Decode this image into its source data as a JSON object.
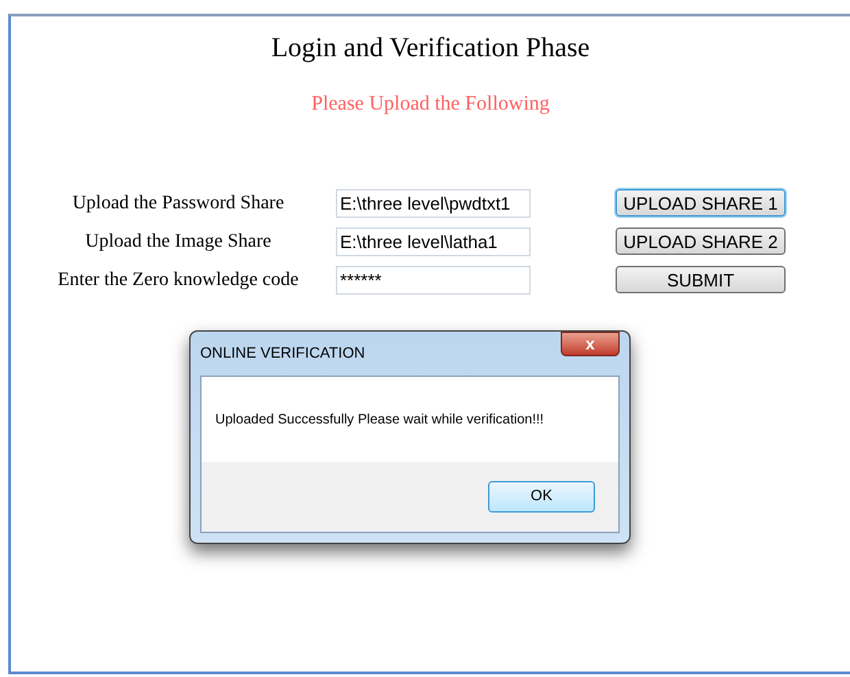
{
  "page": {
    "title": "Login and Verification Phase",
    "subtitle": "Please Upload the Following"
  },
  "rows": [
    {
      "label": "Upload the Password Share",
      "value": "E:\\three level\\pwdtxt1",
      "button": "UPLOAD SHARE 1",
      "focused": true
    },
    {
      "label": "Upload the Image Share",
      "value": "E:\\three level\\latha1",
      "button": "UPLOAD SHARE 2",
      "focused": false
    },
    {
      "label": "Enter the Zero knowledge code",
      "value": "******",
      "button": "SUBMIT",
      "focused": false
    }
  ],
  "dialog": {
    "title": "ONLINE VERIFICATION",
    "close": "x",
    "message": "Uploaded Successfully Please wait while verification!!!",
    "button": "OK"
  }
}
